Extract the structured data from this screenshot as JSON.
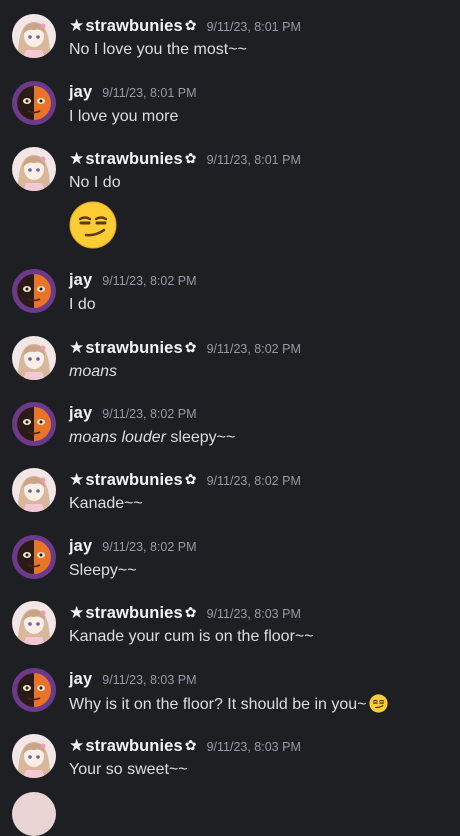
{
  "messages": [
    {
      "author": "strawbunies",
      "timestamp": "9/11/23, 8:01 PM",
      "text": "No I love you the most~~"
    },
    {
      "author": "jay",
      "timestamp": "9/11/23, 8:01 PM",
      "text": "I love you more"
    },
    {
      "author": "strawbunies",
      "timestamp": "9/11/23, 8:01 PM",
      "text": "No I do",
      "emoji": "smirking-face"
    },
    {
      "author": "jay",
      "timestamp": "9/11/23, 8:02 PM",
      "text": "I do"
    },
    {
      "author": "strawbunies",
      "timestamp": "9/11/23, 8:02 PM",
      "text_italic": "moans"
    },
    {
      "author": "jay",
      "timestamp": "9/11/23, 8:02 PM",
      "text_italic": "moans louder",
      "text_rest": " sleepy~~"
    },
    {
      "author": "strawbunies",
      "timestamp": "9/11/23, 8:02 PM",
      "text": "Kanade~~"
    },
    {
      "author": "jay",
      "timestamp": "9/11/23, 8:02 PM",
      "text": "Sleepy~~"
    },
    {
      "author": "strawbunies",
      "timestamp": "9/11/23, 8:03 PM",
      "text": "Kanade your cum is on the floor~~"
    },
    {
      "author": "jay",
      "timestamp": "9/11/23, 8:03 PM",
      "text": "Why is it on the floor? It should be in you~",
      "inline_emoji": "smirking-face"
    },
    {
      "author": "strawbunies",
      "timestamp": "9/11/23, 8:03 PM",
      "text": "Your so sweet~~"
    }
  ],
  "author_decorations": {
    "strawbunies": {
      "prefix": "★",
      "suffix": "✿"
    }
  },
  "colors": {
    "background": "#1e1f22",
    "username": "#f2f3f5",
    "timestamp": "#949ba4",
    "message_text": "#dbdee1"
  }
}
